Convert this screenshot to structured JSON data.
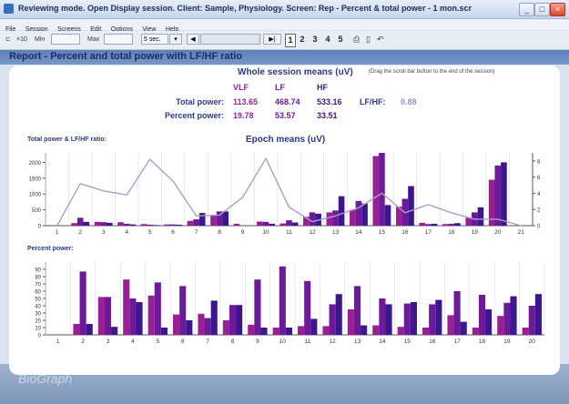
{
  "window": {
    "title": "Reviewing mode. Open Display session. Client: Sample, Physiology. Screen: Rep - Percent & total power - 1 mon.scr",
    "min_label": "_",
    "max_label": "□",
    "close_label": "×"
  },
  "menu": [
    "File",
    "Session",
    "Screens",
    "Edit",
    "Options",
    "View",
    "Help"
  ],
  "toolbar": {
    "scale_label": "×10",
    "min_label": "Min",
    "max_label": "Max",
    "interval_value": "5 sec.",
    "pages": [
      "1",
      "2",
      "3",
      "4",
      "5"
    ],
    "selected_page": "1"
  },
  "report": {
    "title": "Report - Percent and total power with LF/HF ratio",
    "whole_title": "Whole session means (uV)",
    "hint": "(Drag the scroll bar button to the end of the session)",
    "columns": [
      "VLF",
      "LF",
      "HF"
    ],
    "column_colors": [
      "#9b1f94",
      "#6c1a9a",
      "#3b168c"
    ],
    "total_label": "Total power:",
    "percent_label": "Percent power:",
    "total_values": [
      "113.65",
      "468.74",
      "533.16"
    ],
    "percent_values": [
      "19.78",
      "53.57",
      "33.51"
    ],
    "ratio_label": "LF/HF:",
    "ratio_value": "0.88",
    "ratio_color": "#8a95c8",
    "total_section_label": "Total power & LF/HF ratio:",
    "epoch_title": "Epoch means (uV)",
    "percent_section_label": "Percent power:",
    "logo_text": "BioGraph"
  },
  "chart_data": [
    {
      "type": "bar",
      "name": "Total power & LF/HF ratio",
      "categories": [
        "1",
        "2",
        "3",
        "4",
        "5",
        "6",
        "7",
        "8",
        "9",
        "10",
        "11",
        "12",
        "13",
        "14",
        "15",
        "16",
        "17",
        "18",
        "19",
        "20",
        "21"
      ],
      "series": [
        {
          "name": "VLF",
          "color": "#9b1f94",
          "values": [
            0,
            80,
            120,
            110,
            50,
            40,
            150,
            320,
            60,
            130,
            70,
            280,
            420,
            500,
            2200,
            600,
            90,
            50,
            250,
            1450,
            0
          ]
        },
        {
          "name": "LF",
          "color": "#6c1a9a",
          "values": [
            0,
            250,
            110,
            60,
            30,
            40,
            200,
            450,
            0,
            120,
            170,
            420,
            480,
            780,
            2350,
            850,
            50,
            60,
            420,
            1900,
            0
          ]
        },
        {
          "name": "HF",
          "color": "#3b168c",
          "values": [
            0,
            120,
            90,
            40,
            20,
            30,
            400,
            450,
            0,
            60,
            100,
            380,
            930,
            700,
            650,
            1250,
            60,
            80,
            580,
            2000,
            0
          ]
        }
      ],
      "ratio_series": {
        "name": "LF/HF",
        "values": [
          0,
          5.2,
          4.3,
          3.8,
          8.2,
          5.5,
          1.2,
          1.3,
          3.5,
          8.3,
          2.3,
          0.5,
          1.2,
          2.2,
          4.0,
          1.6,
          2.6,
          1.6,
          0.8,
          0.8,
          0
        ]
      },
      "ylim": [
        0,
        2300
      ],
      "yticks": [
        0,
        500,
        1000,
        1500,
        2000
      ],
      "y2lim": [
        0,
        9
      ],
      "y2ticks": [
        0,
        2,
        4,
        6,
        8
      ]
    },
    {
      "type": "bar",
      "name": "Percent power",
      "categories": [
        "1",
        "2",
        "3",
        "4",
        "5",
        "6",
        "7",
        "8",
        "9",
        "10",
        "11",
        "12",
        "13",
        "14",
        "15",
        "16",
        "17",
        "18",
        "19",
        "20"
      ],
      "series": [
        {
          "name": "VLF",
          "color": "#9b1f94",
          "values": [
            0,
            15,
            52,
            76,
            54,
            28,
            29,
            20,
            14,
            10,
            12,
            12,
            35,
            13,
            11,
            10,
            27,
            10,
            26,
            10
          ]
        },
        {
          "name": "LF",
          "color": "#6c1a9a",
          "values": [
            0,
            87,
            52,
            50,
            72,
            67,
            23,
            41,
            76,
            94,
            74,
            42,
            67,
            50,
            43,
            42,
            60,
            55,
            44,
            40
          ]
        },
        {
          "name": "HF",
          "color": "#3b168c",
          "values": [
            0,
            15,
            11,
            45,
            10,
            20,
            47,
            41,
            10,
            10,
            22,
            56,
            13,
            42,
            45,
            48,
            18,
            35,
            53,
            56
          ]
        }
      ],
      "ylim": [
        0,
        100
      ],
      "yticks": [
        0,
        10,
        20,
        30,
        40,
        50,
        60,
        70,
        80,
        90
      ]
    }
  ]
}
